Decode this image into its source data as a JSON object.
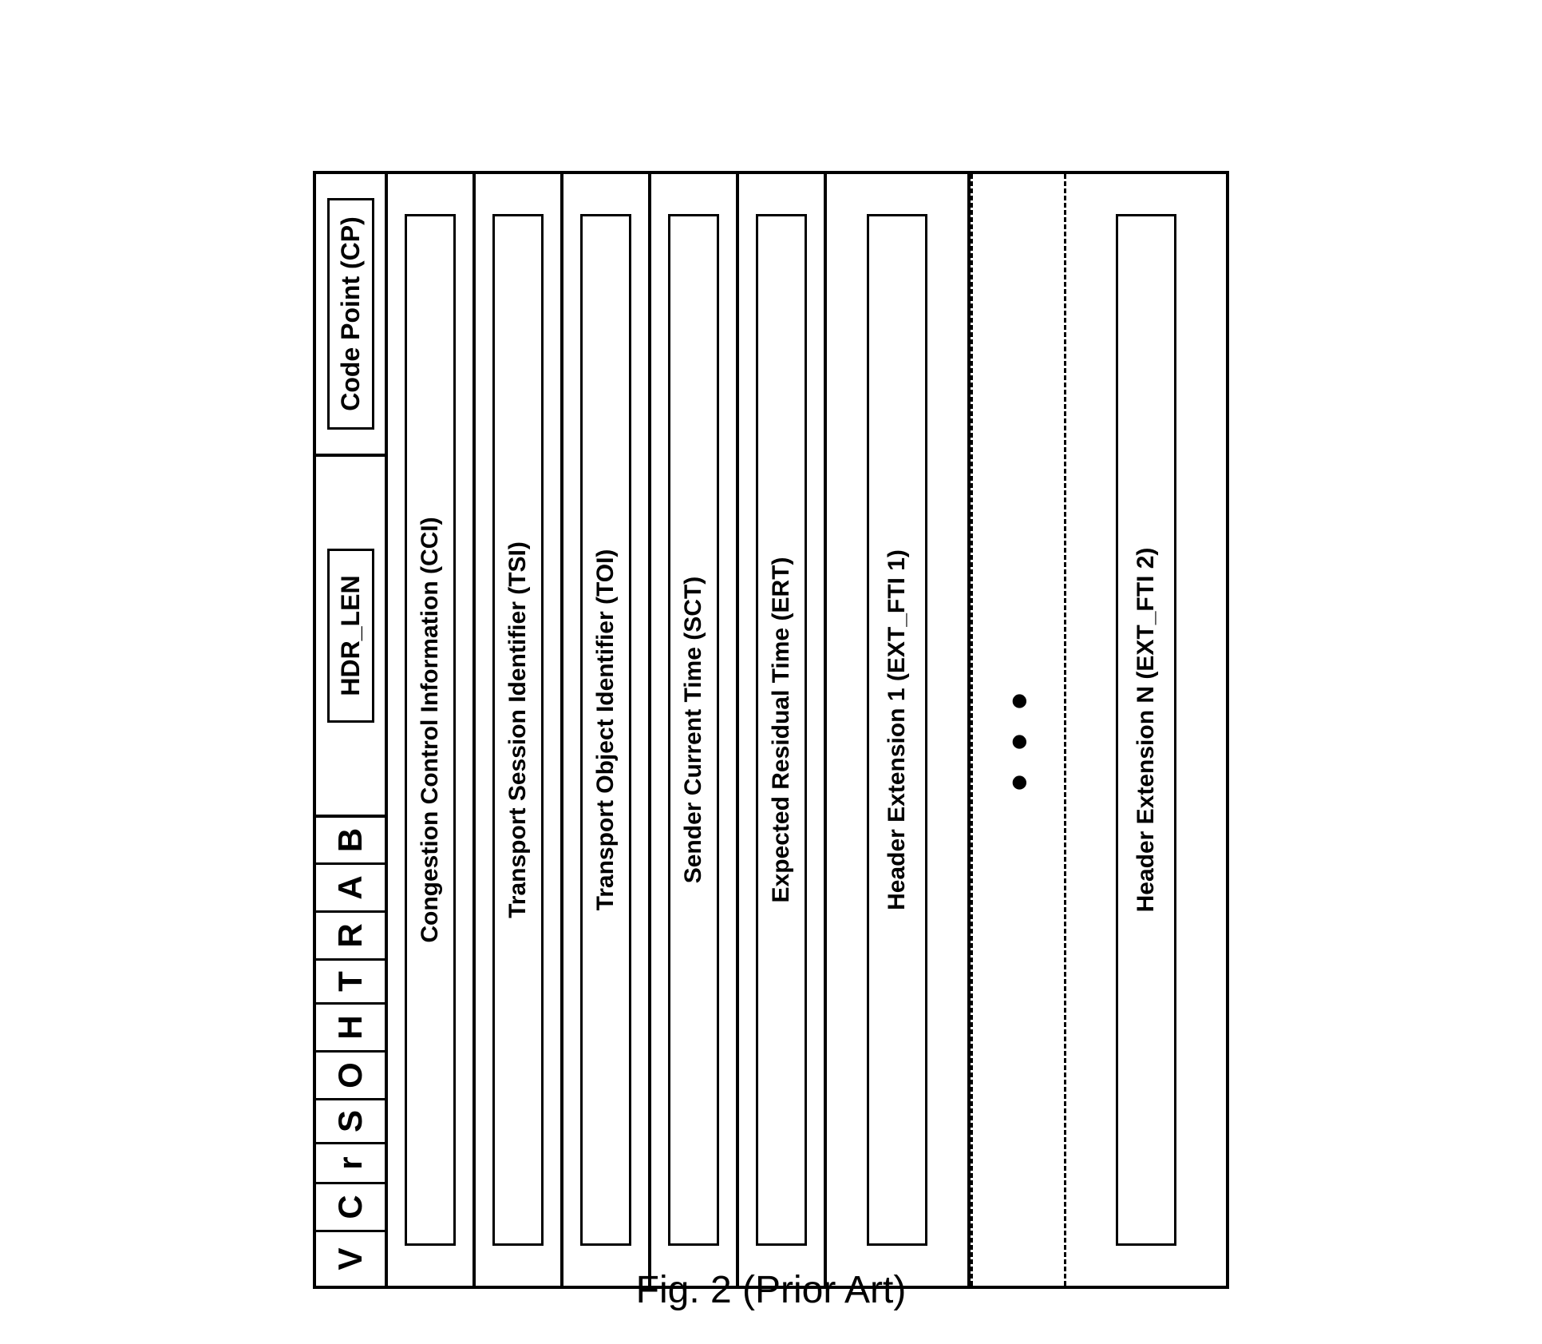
{
  "diagram": {
    "header_flags": {
      "v": "V",
      "c": "C",
      "r": "r",
      "s": "S",
      "o": "O",
      "h": "H",
      "t": "T",
      "r2": "R",
      "a": "A",
      "b": "B"
    },
    "hdr_len_label": "HDR_LEN",
    "code_point_label": "Code Point (CP)",
    "fields": {
      "cci": "Congestion Control Information (CCI)",
      "tsi": "Transport Session Identifier (TSI)",
      "toi": "Transport Object Identifier (TOI)",
      "sct": "Sender Current Time (SCT)",
      "ert": "Expected Residual Time (ERT)",
      "ext1": "Header Extension 1 (EXT_FTI 1)",
      "extn": "Header Extension N (EXT_FTI 2)"
    },
    "ellipsis": "•••",
    "caption": "Fig. 2 (Prior Art)"
  }
}
